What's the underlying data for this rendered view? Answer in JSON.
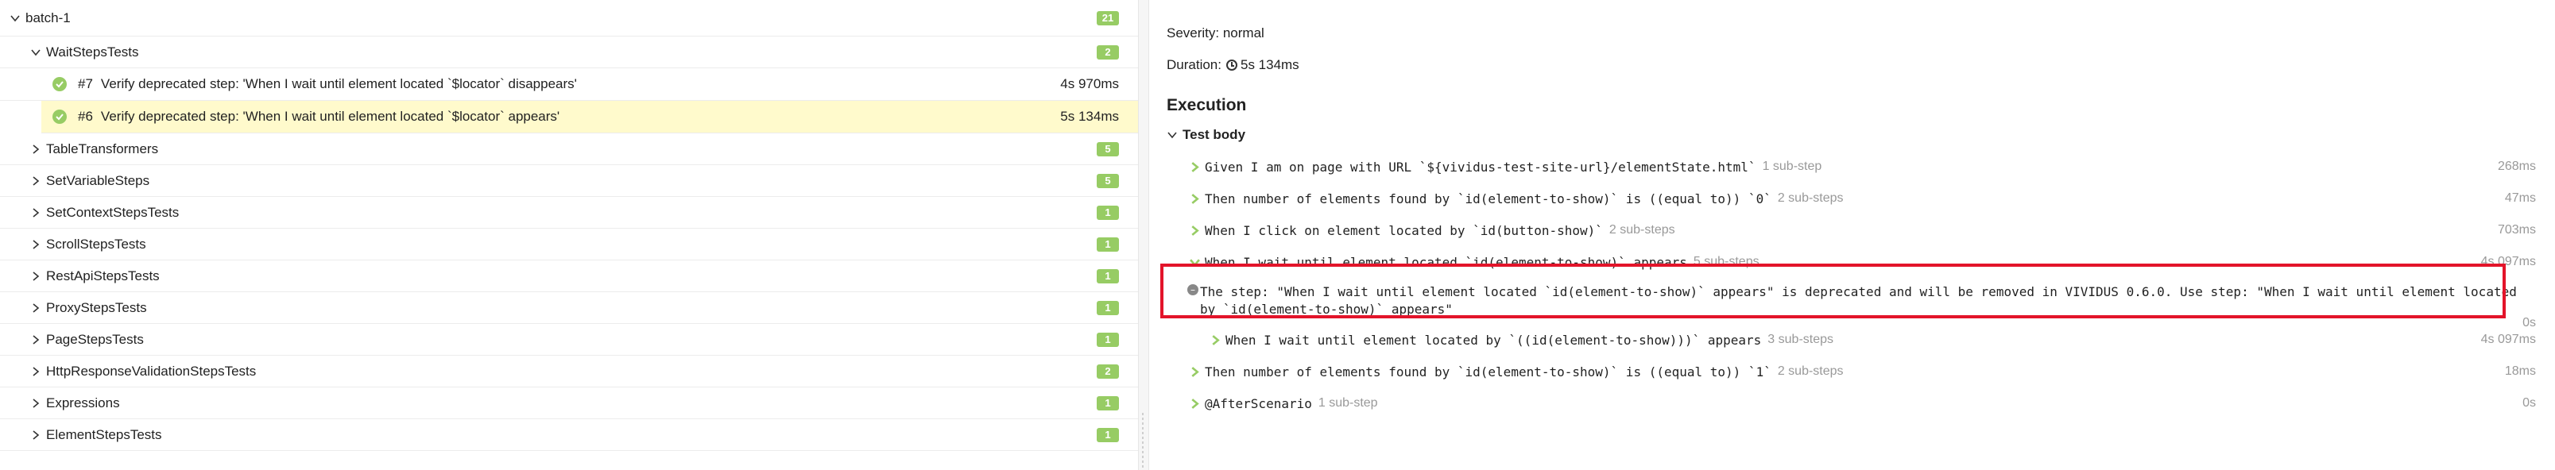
{
  "tree": {
    "root": {
      "label": "batch-1",
      "count": "21"
    },
    "groups": [
      {
        "label": "WaitStepsTests",
        "count": "2",
        "expanded": true,
        "cases": [
          {
            "num": "#7",
            "title": "Verify deprecated step: 'When I wait until element located `$locator` disappears'",
            "duration": "4s 970ms",
            "selected": false
          },
          {
            "num": "#6",
            "title": "Verify deprecated step: 'When I wait until element located `$locator` appears'",
            "duration": "5s 134ms",
            "selected": true
          }
        ]
      },
      {
        "label": "TableTransformers",
        "count": "5"
      },
      {
        "label": "SetVariableSteps",
        "count": "5"
      },
      {
        "label": "SetContextStepsTests",
        "count": "1"
      },
      {
        "label": "ScrollStepsTests",
        "count": "1"
      },
      {
        "label": "RestApiStepsTests",
        "count": "1"
      },
      {
        "label": "ProxyStepsTests",
        "count": "1"
      },
      {
        "label": "PageStepsTests",
        "count": "1"
      },
      {
        "label": "HttpResponseValidationStepsTests",
        "count": "2"
      },
      {
        "label": "Expressions",
        "count": "1"
      },
      {
        "label": "ElementStepsTests",
        "count": "1"
      }
    ]
  },
  "details": {
    "severity": "Severity: normal",
    "duration_label": "Duration:",
    "duration_value": "5s 134ms",
    "execution_title": "Execution",
    "test_body_title": "Test body",
    "steps": [
      {
        "text": "Given I am on page with URL `${vividus-test-site-url}/elementState.html`",
        "sub": "1 sub-step",
        "duration": "268ms"
      },
      {
        "text": "Then number of elements found by `id(element-to-show)` is ((equal to)) `0`",
        "sub": "2 sub-steps",
        "duration": "47ms"
      },
      {
        "text": "When I click on element located by `id(button-show)`",
        "sub": "2 sub-steps",
        "duration": "703ms"
      },
      {
        "text": "When I wait until element located `id(element-to-show)` appears",
        "sub": "5 sub-steps",
        "duration": "4s 097ms"
      }
    ],
    "deprecation_message": "The step: \"When I wait until element located `id(element-to-show)` appears\" is deprecated and will be removed in VIVIDUS 0.6.0. Use step: \"When I wait until element located by `id(element-to-show)` appears\"",
    "deprecation_duration": "0s",
    "nested_step": {
      "text": "When I wait until element located by `((id(element-to-show)))` appears",
      "sub": "3 sub-steps",
      "duration": "4s 097ms"
    },
    "steps_after": [
      {
        "text": "Then number of elements found by `id(element-to-show)` is ((equal to)) `1`",
        "sub": "2 sub-steps",
        "duration": "18ms"
      },
      {
        "text": "@AfterScenario",
        "sub": "1 sub-step",
        "duration": "0s"
      }
    ]
  },
  "colors": {
    "passed": "#97cc64",
    "selected_row": "#fffacc",
    "highlight_border": "#e3142a"
  }
}
